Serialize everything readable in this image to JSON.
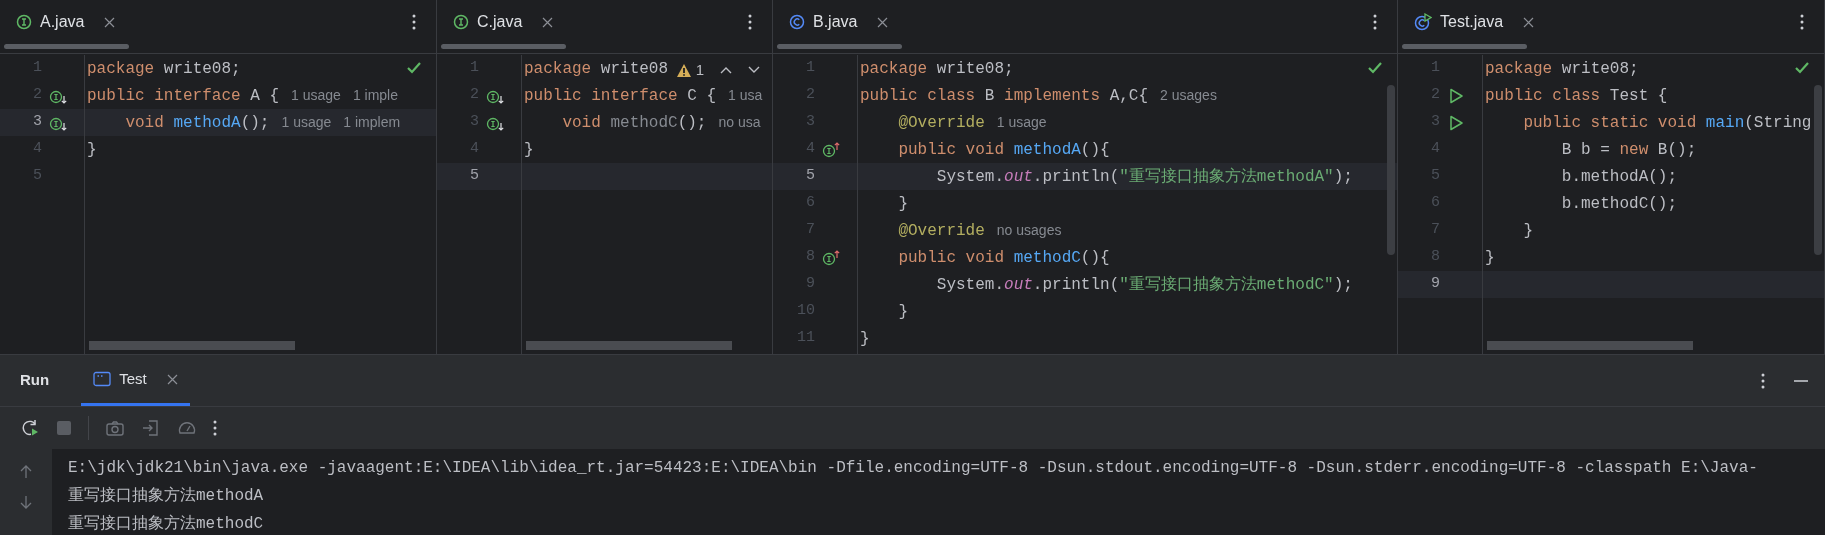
{
  "editors": [
    {
      "tab": {
        "label": "A.java",
        "kind": "interface"
      },
      "inspection": {
        "kind": "ok"
      },
      "lines": [
        {
          "number": "1",
          "current": false,
          "code": [
            {
              "kind": "keyword",
              "text": "package"
            },
            {
              "kind": "plain",
              "text": " write08;"
            }
          ]
        },
        {
          "number": "2",
          "current": false,
          "gutter": {
            "kind": "implemented"
          },
          "code": [
            {
              "kind": "keyword",
              "text": "public interface "
            },
            {
              "kind": "plain",
              "text": "A {"
            }
          ],
          "hints": [
            "1 usage",
            "1 imple"
          ]
        },
        {
          "number": "3",
          "current": true,
          "gutter": {
            "kind": "implemented"
          },
          "code": [
            {
              "kind": "keyword",
              "text": "    void "
            },
            {
              "kind": "method",
              "text": "methodA"
            },
            {
              "kind": "plain",
              "text": "();"
            }
          ],
          "hints": [
            "1 usage",
            "1 implem"
          ]
        },
        {
          "number": "4",
          "current": false,
          "code": [
            {
              "kind": "plain",
              "text": "}"
            }
          ]
        },
        {
          "number": "5",
          "current": false
        }
      ]
    },
    {
      "tab": {
        "label": "C.java",
        "kind": "interface"
      },
      "inspection": {
        "kind": "warning",
        "count": "1"
      },
      "lines": [
        {
          "number": "1",
          "current": false,
          "code": [
            {
              "kind": "keyword",
              "text": "package"
            },
            {
              "kind": "plain",
              "text": " write08"
            }
          ]
        },
        {
          "number": "2",
          "current": false,
          "gutter": {
            "kind": "implemented"
          },
          "code": [
            {
              "kind": "keyword",
              "text": "public interface "
            },
            {
              "kind": "plain",
              "text": "C {"
            }
          ],
          "hints": [
            "1 usa"
          ]
        },
        {
          "number": "3",
          "current": false,
          "gutter": {
            "kind": "implemented"
          },
          "code": [
            {
              "kind": "keyword",
              "text": "    void "
            },
            {
              "kind": "unused",
              "text": "methodC"
            },
            {
              "kind": "plain",
              "text": "();"
            }
          ],
          "hints": [
            "no usa"
          ]
        },
        {
          "number": "4",
          "current": false,
          "code": [
            {
              "kind": "plain",
              "text": "}"
            }
          ]
        },
        {
          "number": "5",
          "current": true
        }
      ]
    },
    {
      "tab": {
        "label": "B.java",
        "kind": "class"
      },
      "inspection": {
        "kind": "ok"
      },
      "lines": [
        {
          "number": "1",
          "current": false,
          "code": [
            {
              "kind": "keyword",
              "text": "package"
            },
            {
              "kind": "plain",
              "text": " write08;"
            }
          ]
        },
        {
          "number": "2",
          "current": false,
          "code": [
            {
              "kind": "keyword",
              "text": "public class "
            },
            {
              "kind": "plain",
              "text": "B "
            },
            {
              "kind": "keyword",
              "text": "implements "
            },
            {
              "kind": "plain",
              "text": "A,C{"
            }
          ],
          "hints": [
            "2 usages"
          ]
        },
        {
          "number": "3",
          "current": false,
          "code": [
            {
              "kind": "annotation",
              "text": "    @Override"
            }
          ],
          "hints": [
            "1 usage"
          ]
        },
        {
          "number": "4",
          "current": false,
          "gutter": {
            "kind": "implementing"
          },
          "code": [
            {
              "kind": "keyword",
              "text": "    public void "
            },
            {
              "kind": "method",
              "text": "methodA"
            },
            {
              "kind": "plain",
              "text": "(){"
            }
          ]
        },
        {
          "number": "5",
          "current": true,
          "code": [
            {
              "kind": "plain",
              "text": "        System."
            },
            {
              "kind": "static",
              "text": "out"
            },
            {
              "kind": "plain",
              "text": ".println("
            },
            {
              "kind": "string",
              "text": "\"重写接口抽象方法methodA\""
            },
            {
              "kind": "plain",
              "text": ");"
            }
          ]
        },
        {
          "number": "6",
          "current": false,
          "code": [
            {
              "kind": "plain",
              "text": "    }"
            }
          ]
        },
        {
          "number": "7",
          "current": false,
          "code": [
            {
              "kind": "annotation",
              "text": "    @Override"
            }
          ],
          "hints": [
            "no usages"
          ]
        },
        {
          "number": "8",
          "current": false,
          "gutter": {
            "kind": "implementing"
          },
          "code": [
            {
              "kind": "keyword",
              "text": "    public void "
            },
            {
              "kind": "method",
              "text": "methodC"
            },
            {
              "kind": "plain",
              "text": "(){"
            }
          ]
        },
        {
          "number": "9",
          "current": false,
          "code": [
            {
              "kind": "plain",
              "text": "        System."
            },
            {
              "kind": "static",
              "text": "out"
            },
            {
              "kind": "plain",
              "text": ".println("
            },
            {
              "kind": "string",
              "text": "\"重写接口抽象方法methodC\""
            },
            {
              "kind": "plain",
              "text": ");"
            }
          ]
        },
        {
          "number": "10",
          "current": false,
          "code": [
            {
              "kind": "plain",
              "text": "    }"
            }
          ]
        },
        {
          "number": "11",
          "current": false,
          "code": [
            {
              "kind": "plain",
              "text": "}"
            }
          ]
        }
      ]
    },
    {
      "tab": {
        "label": "Test.java",
        "kind": "runnable_class"
      },
      "inspection": {
        "kind": "ok"
      },
      "lines": [
        {
          "number": "1",
          "current": false,
          "code": [
            {
              "kind": "keyword",
              "text": "package"
            },
            {
              "kind": "plain",
              "text": " write08;"
            }
          ]
        },
        {
          "number": "2",
          "current": false,
          "gutter": {
            "kind": "run"
          },
          "code": [
            {
              "kind": "keyword",
              "text": "public class "
            },
            {
              "kind": "plain",
              "text": "Test {"
            }
          ]
        },
        {
          "number": "3",
          "current": false,
          "gutter": {
            "kind": "run"
          },
          "code": [
            {
              "kind": "keyword",
              "text": "    public static void "
            },
            {
              "kind": "method",
              "text": "main"
            },
            {
              "kind": "plain",
              "text": "(String"
            }
          ]
        },
        {
          "number": "4",
          "current": false,
          "code": [
            {
              "kind": "plain",
              "text": "        B b = "
            },
            {
              "kind": "keyword",
              "text": "new "
            },
            {
              "kind": "plain",
              "text": "B();"
            }
          ]
        },
        {
          "number": "5",
          "current": false,
          "code": [
            {
              "kind": "plain",
              "text": "        b.methodA();"
            }
          ]
        },
        {
          "number": "6",
          "current": false,
          "code": [
            {
              "kind": "plain",
              "text": "        b.methodC();"
            }
          ]
        },
        {
          "number": "7",
          "current": false,
          "code": [
            {
              "kind": "plain",
              "text": "    }"
            }
          ]
        },
        {
          "number": "8",
          "current": false,
          "code": [
            {
              "kind": "plain",
              "text": "}"
            }
          ]
        },
        {
          "number": "9",
          "current": true
        }
      ]
    }
  ],
  "run_panel": {
    "title": "Run",
    "tabs": [
      {
        "label": "Test",
        "selected": true
      }
    ],
    "console": [
      "E:\\jdk\\jdk21\\bin\\java.exe -javaagent:E:\\IDEA\\lib\\idea_rt.jar=54423:E:\\IDEA\\bin -Dfile.encoding=UTF-8 -Dsun.stdout.encoding=UTF-8 -Dsun.stderr.encoding=UTF-8 -classpath E:\\Java-",
      "重写接口抽象方法methodA",
      "重写接口抽象方法methodC"
    ]
  }
}
